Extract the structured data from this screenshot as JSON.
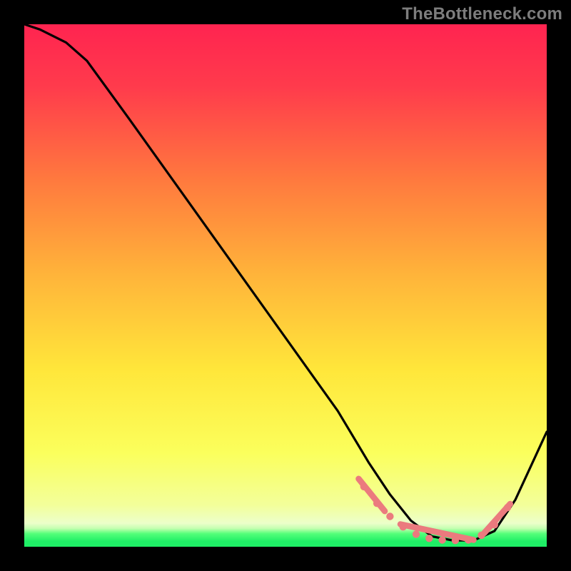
{
  "watermark": "TheBottleneck.com",
  "chart_data": {
    "type": "line",
    "title": "",
    "xlabel": "",
    "ylabel": "",
    "xlim": [
      0,
      100
    ],
    "ylim": [
      0,
      100
    ],
    "grid": false,
    "legend": false,
    "background_gradient": {
      "top": "#ff2450",
      "upper_mid": "#ff8a3a",
      "mid": "#ffe63a",
      "lower": "#faff70",
      "green_band": "#24ff70"
    },
    "series": [
      {
        "name": "curve",
        "color": "#000000",
        "x": [
          0,
          3,
          8,
          12,
          20,
          30,
          40,
          50,
          60,
          66,
          70,
          74,
          78,
          82,
          86,
          90,
          94,
          100
        ],
        "y": [
          100,
          99,
          96.5,
          93,
          82,
          68,
          54,
          40,
          26,
          16,
          10,
          5,
          2,
          1.2,
          1.2,
          3,
          9,
          22
        ]
      }
    ],
    "highlight_points": {
      "name": "pink-dots",
      "color": "#eb7a7e",
      "x": [
        65,
        67.5,
        70,
        72.5,
        75,
        77.5,
        80,
        82.5,
        85,
        87.5,
        90,
        92.5
      ],
      "y": [
        11.5,
        8.3,
        5.8,
        3.8,
        2.4,
        1.6,
        1.3,
        1.2,
        1.3,
        2.2,
        4.2,
        7.5
      ]
    },
    "highlight_segments": {
      "name": "pink-thick-segments",
      "color": "#eb7a7e",
      "segments": [
        {
          "x": [
            64,
            69
          ],
          "y": [
            13,
            6.8
          ]
        },
        {
          "x": [
            72,
            86
          ],
          "y": [
            4.3,
            1.3
          ]
        },
        {
          "x": [
            88,
            93
          ],
          "y": [
            2.6,
            8.2
          ]
        }
      ]
    }
  }
}
